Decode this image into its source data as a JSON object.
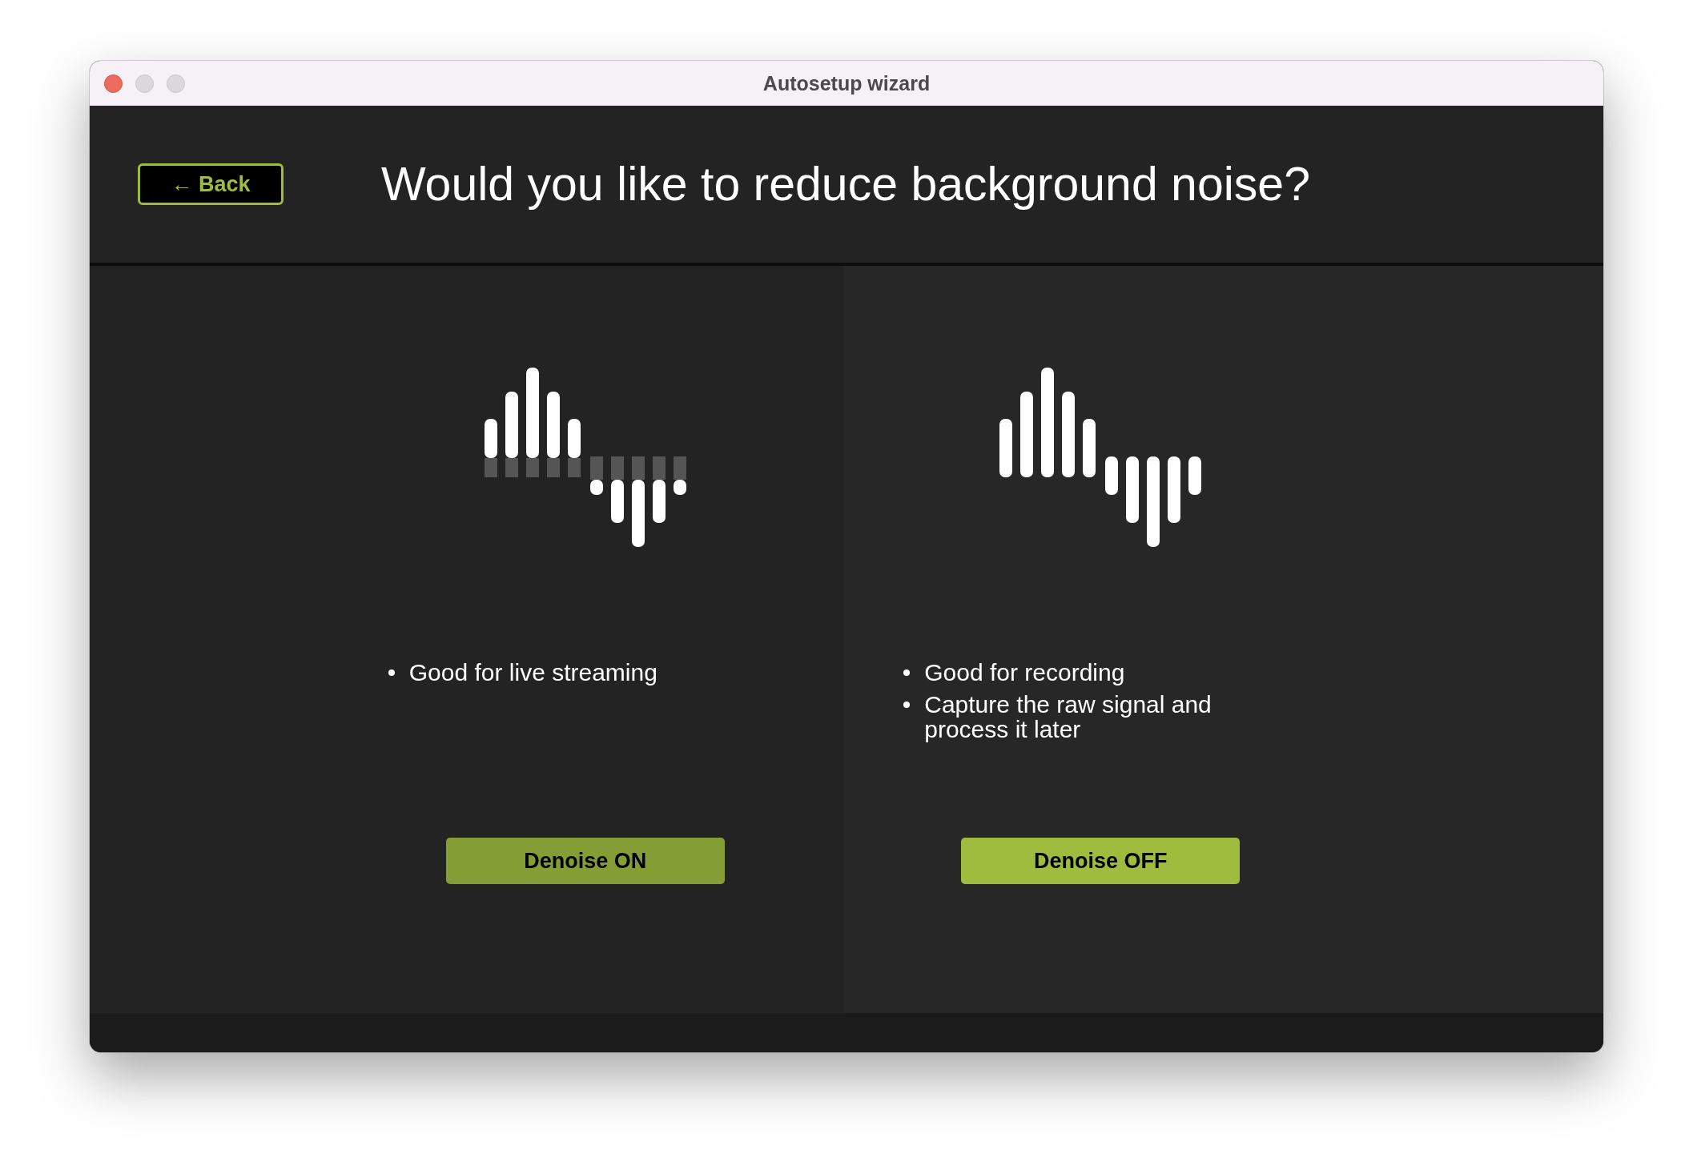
{
  "window": {
    "title": "Autosetup wizard"
  },
  "back_button": {
    "label": "← Back"
  },
  "heading": "Would you like to reduce background noise?",
  "panels": [
    {
      "kind": "denoised",
      "bullets": [
        "Good for live streaming"
      ],
      "button": {
        "label": "Denoise ON",
        "pressed": true
      }
    },
    {
      "kind": "raw",
      "bullets": [
        "Good for recording",
        "Capture the raw signal and process it later"
      ],
      "button": {
        "label": "Denoise OFF",
        "pressed": false
      }
    }
  ]
}
